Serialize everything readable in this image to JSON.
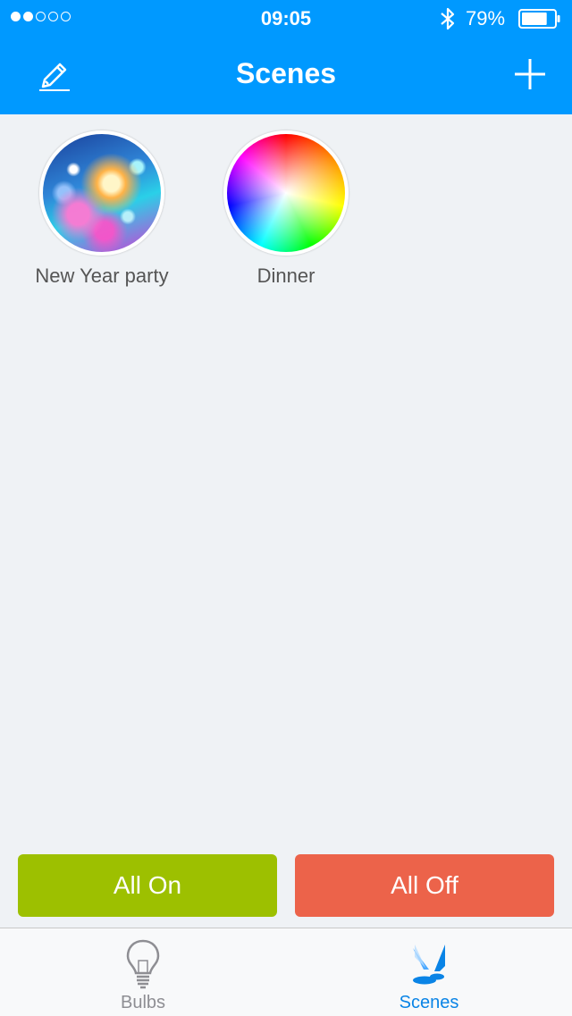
{
  "status_bar": {
    "time": "09:05",
    "battery_percent": "79%",
    "battery_level": 0.79,
    "signal_bars_filled": 2,
    "signal_bars_total": 5,
    "icons": [
      "signal-dots-icon",
      "bluetooth-icon",
      "battery-icon"
    ]
  },
  "header": {
    "title": "Scenes",
    "left_icon": "pencil-edit-icon",
    "right_icon": "plus-icon",
    "background": "#0099ff"
  },
  "scenes": [
    {
      "label": "New Year party",
      "thumbnail": "party-sparkler-photo"
    },
    {
      "label": "Dinner",
      "thumbnail": "color-wheel"
    }
  ],
  "actions": {
    "all_on": {
      "label": "All On",
      "color": "#9dc000"
    },
    "all_off": {
      "label": "All Off",
      "color": "#ec634a"
    }
  },
  "tabbar": {
    "tabs": [
      {
        "label": "Bulbs",
        "icon": "lightbulb-icon",
        "selected": false
      },
      {
        "label": "Scenes",
        "icon": "spotlight-icon",
        "selected": true
      }
    ],
    "selected_color": "#0a84e6"
  }
}
